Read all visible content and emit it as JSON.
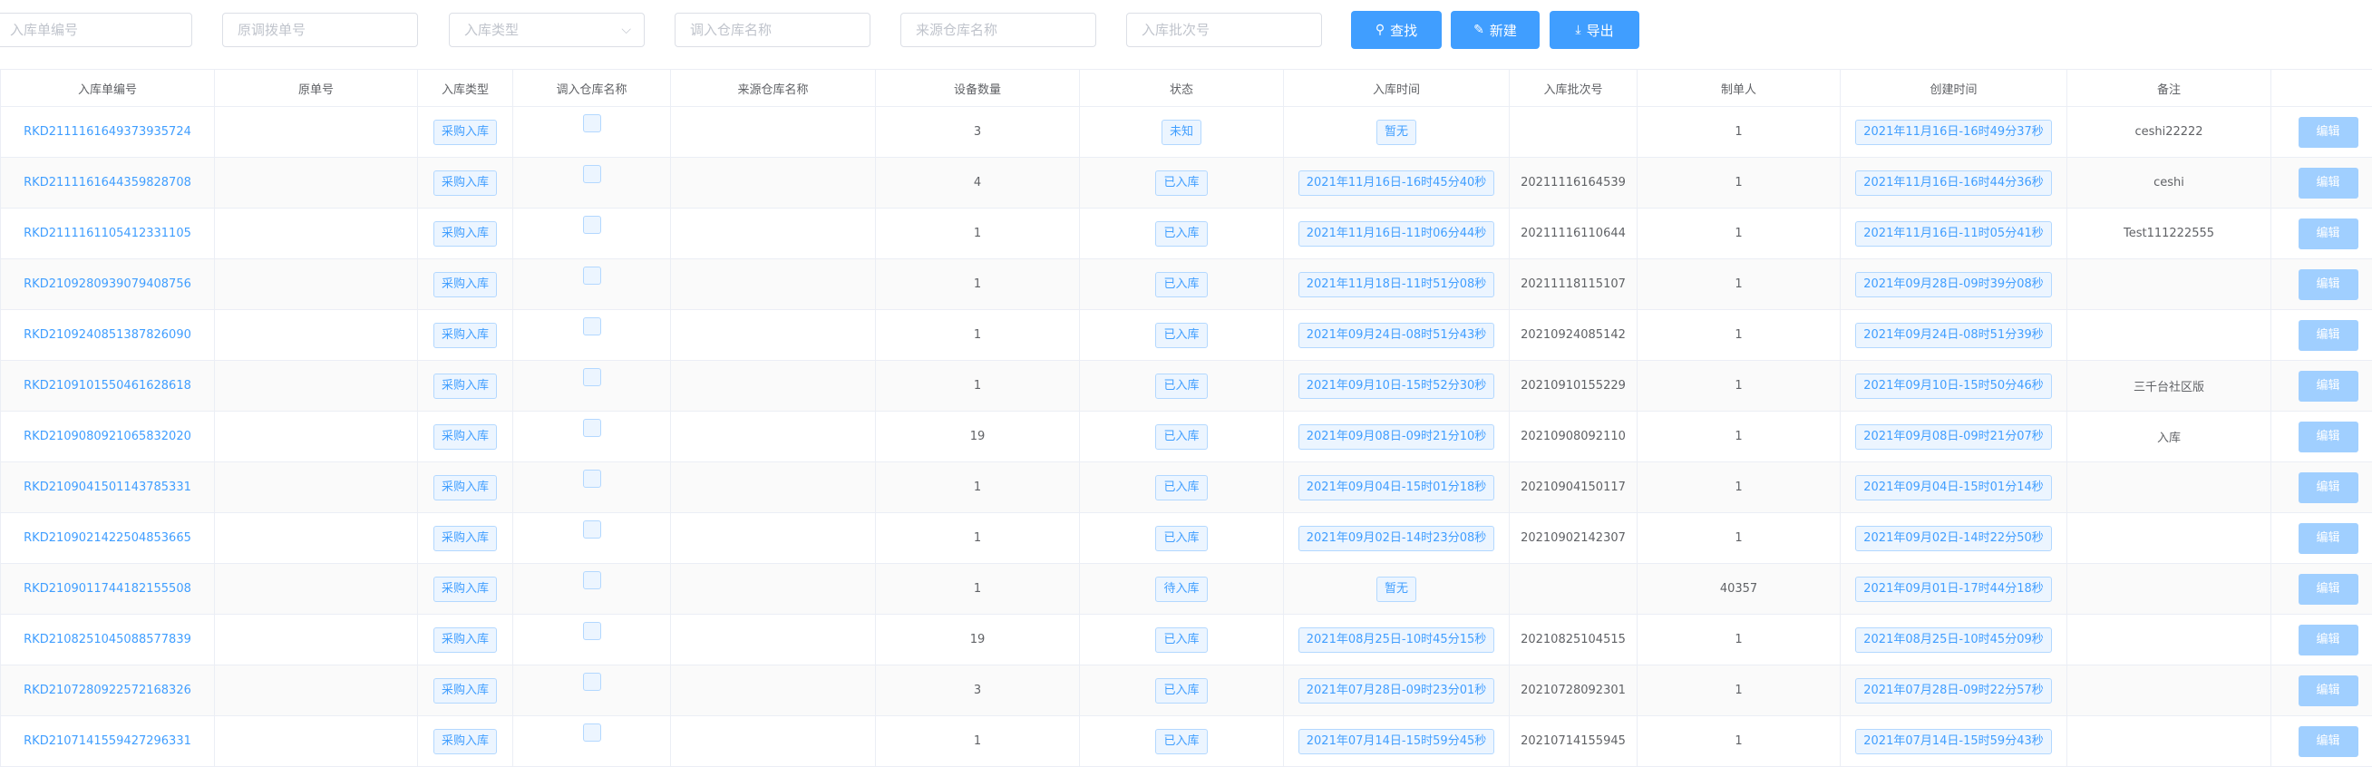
{
  "filters": {
    "order_no": "入库单编号",
    "transfer_no": "原调拨单号",
    "type": "入库类型",
    "in_warehouse": "调入仓库名称",
    "src_warehouse": "来源仓库名称",
    "batch_no": "入库批次号"
  },
  "buttons": {
    "search": "查找",
    "create": "新建",
    "export": "导出",
    "edit": "编辑"
  },
  "colors": {
    "primary": "#409eff",
    "tag_bg": "#ecf5ff",
    "tag_border": "#b3d8ff",
    "edit_bg": "#a0cfff"
  },
  "icons": {
    "search": "search-icon",
    "create": "edit-pen-icon",
    "export": "download-icon",
    "select": "chevron-down-icon"
  },
  "columns": [
    "入库单编号",
    "原单号",
    "入库类型",
    "调入仓库名称",
    "来源仓库名称",
    "设备数量",
    "状态",
    "入库时间",
    "入库批次号",
    "制单人",
    "创建时间",
    "备注"
  ],
  "rows": [
    {
      "id": "RKD2111161649373935724",
      "orig": "",
      "type": "采购入库",
      "qty": "3",
      "status": "未知",
      "in_time": "暂无",
      "batch": "",
      "maker": "1",
      "created": "2021年11月16日-16时49分37秒",
      "note": "ceshi22222"
    },
    {
      "id": "RKD2111161644359828708",
      "orig": "",
      "type": "采购入库",
      "qty": "4",
      "status": "已入库",
      "in_time": "2021年11月16日-16时45分40秒",
      "batch": "20211116164539",
      "maker": "1",
      "created": "2021年11月16日-16时44分36秒",
      "note": "ceshi"
    },
    {
      "id": "RKD2111161105412331105",
      "orig": "",
      "type": "采购入库",
      "qty": "1",
      "status": "已入库",
      "in_time": "2021年11月16日-11时06分44秒",
      "batch": "20211116110644",
      "maker": "1",
      "created": "2021年11月16日-11时05分41秒",
      "note": "Test111222555"
    },
    {
      "id": "RKD2109280939079408756",
      "orig": "",
      "type": "采购入库",
      "qty": "1",
      "status": "已入库",
      "in_time": "2021年11月18日-11时51分08秒",
      "batch": "20211118115107",
      "maker": "1",
      "created": "2021年09月28日-09时39分08秒",
      "note": ""
    },
    {
      "id": "RKD2109240851387826090",
      "orig": "",
      "type": "采购入库",
      "qty": "1",
      "status": "已入库",
      "in_time": "2021年09月24日-08时51分43秒",
      "batch": "20210924085142",
      "maker": "1",
      "created": "2021年09月24日-08时51分39秒",
      "note": ""
    },
    {
      "id": "RKD2109101550461628618",
      "orig": "",
      "type": "采购入库",
      "qty": "1",
      "status": "已入库",
      "in_time": "2021年09月10日-15时52分30秒",
      "batch": "20210910155229",
      "maker": "1",
      "created": "2021年09月10日-15时50分46秒",
      "note": "三千台社区版"
    },
    {
      "id": "RKD2109080921065832020",
      "orig": "",
      "type": "采购入库",
      "qty": "19",
      "status": "已入库",
      "in_time": "2021年09月08日-09时21分10秒",
      "batch": "20210908092110",
      "maker": "1",
      "created": "2021年09月08日-09时21分07秒",
      "note": "入库"
    },
    {
      "id": "RKD2109041501143785331",
      "orig": "",
      "type": "采购入库",
      "qty": "1",
      "status": "已入库",
      "in_time": "2021年09月04日-15时01分18秒",
      "batch": "20210904150117",
      "maker": "1",
      "created": "2021年09月04日-15时01分14秒",
      "note": ""
    },
    {
      "id": "RKD2109021422504853665",
      "orig": "",
      "type": "采购入库",
      "qty": "1",
      "status": "已入库",
      "in_time": "2021年09月02日-14时23分08秒",
      "batch": "20210902142307",
      "maker": "1",
      "created": "2021年09月02日-14时22分50秒",
      "note": ""
    },
    {
      "id": "RKD2109011744182155508",
      "orig": "",
      "type": "采购入库",
      "qty": "1",
      "status": "待入库",
      "in_time": "暂无",
      "batch": "",
      "maker": "40357",
      "created": "2021年09月01日-17时44分18秒",
      "note": ""
    },
    {
      "id": "RKD2108251045088577839",
      "orig": "",
      "type": "采购入库",
      "qty": "19",
      "status": "已入库",
      "in_time": "2021年08月25日-10时45分15秒",
      "batch": "20210825104515",
      "maker": "1",
      "created": "2021年08月25日-10时45分09秒",
      "note": ""
    },
    {
      "id": "RKD2107280922572168326",
      "orig": "",
      "type": "采购入库",
      "qty": "3",
      "status": "已入库",
      "in_time": "2021年07月28日-09时23分01秒",
      "batch": "20210728092301",
      "maker": "1",
      "created": "2021年07月28日-09时22分57秒",
      "note": ""
    },
    {
      "id": "RKD2107141559427296331",
      "orig": "",
      "type": "采购入库",
      "qty": "1",
      "status": "已入库",
      "in_time": "2021年07月14日-15时59分45秒",
      "batch": "20210714155945",
      "maker": "1",
      "created": "2021年07月14日-15时59分43秒",
      "note": ""
    }
  ]
}
